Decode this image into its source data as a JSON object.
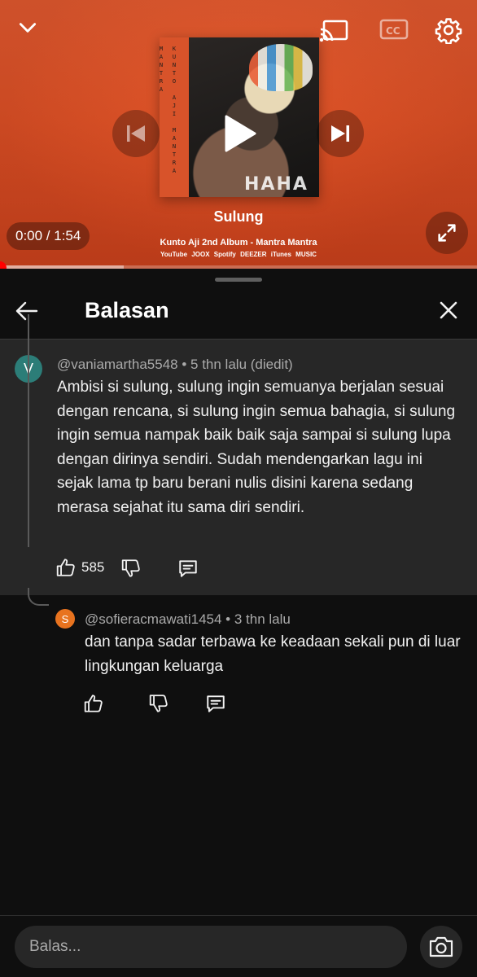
{
  "player": {
    "album_spine_text": "KUNTO AJI MANTRA MANTRA",
    "album_cover_text": "HAHA",
    "song_title": "Sulung",
    "album_line": "Kunto Aji  2nd Album - Mantra Mantra",
    "platforms": "YouTube  JOOX  Spotify  DEEZER  iTunes  MUSIC",
    "time": "0:00 / 1:54",
    "progress_fraction": 0.0,
    "buffer_fraction": 0.26,
    "icons": {
      "collapse": "chevron-down-icon",
      "cast": "cast-icon",
      "captions": "cc-icon",
      "settings": "gear-icon",
      "previous": "previous-icon",
      "play": "play-icon",
      "next": "next-icon",
      "fullscreen": "fullscreen-icon"
    }
  },
  "sheet": {
    "title": "Balasan",
    "back_icon": "back-arrow-icon",
    "close_icon": "close-icon"
  },
  "parent_comment": {
    "avatar_letter": "V",
    "avatar_color": "#2c7d78",
    "meta": "@vaniamartha5548 • 5 thn lalu (diedit)",
    "text": "Ambisi si sulung, sulung ingin semuanya berjalan sesuai dengan rencana, si sulung ingin semua bahagia, si sulung ingin semua nampak baik baik saja sampai si sulung lupa dengan dirinya sendiri. Sudah mendengarkan lagu ini sejak lama tp baru berani nulis disini karena sedang merasa sejahat itu sama diri sendiri.",
    "like_count": "585"
  },
  "reply": {
    "avatar_letter": "S",
    "avatar_color": "#e8731f",
    "meta": "@sofieracmawati1454 • 3 thn lalu",
    "text": "dan tanpa sadar terbawa ke keadaan sekali pun di luar lingkungan keluarga"
  },
  "composer": {
    "placeholder": "Balas...",
    "camera_icon": "camera-icon"
  },
  "colors": {
    "background": "#0f0f0f",
    "highlight_bg": "#272727",
    "player_orange": "#dc4f25",
    "progress_red": "#ff0000"
  }
}
